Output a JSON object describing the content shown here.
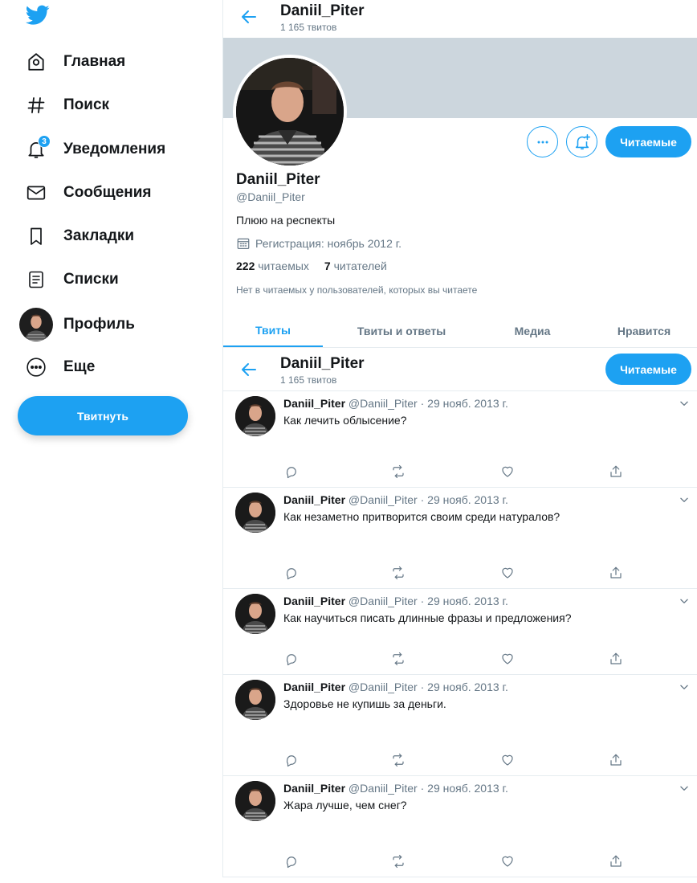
{
  "colors": {
    "accent": "#1da1f2",
    "text": "#14171a",
    "muted": "#657786",
    "banner": "#ccd6dd",
    "border": "#e6ecf0"
  },
  "sidebar": {
    "logo_icon": "twitter-bird-icon",
    "items": [
      {
        "label": "Главная",
        "icon": "home-icon"
      },
      {
        "label": "Поиск",
        "icon": "hashtag-icon"
      },
      {
        "label": "Уведомления",
        "icon": "bell-icon",
        "badge": "3"
      },
      {
        "label": "Сообщения",
        "icon": "envelope-icon"
      },
      {
        "label": "Закладки",
        "icon": "bookmark-icon"
      },
      {
        "label": "Списки",
        "icon": "list-icon"
      },
      {
        "label": "Профиль",
        "icon": "avatar"
      },
      {
        "label": "Еще",
        "icon": "more-icon"
      }
    ],
    "tweet_button": "Твитнуть"
  },
  "header": {
    "title": "Daniil_Piter",
    "subtitle": "1 165 твитов"
  },
  "profile": {
    "name": "Daniil_Piter",
    "handle": "@Daniil_Piter",
    "bio": "Плюю на респекты",
    "joined": "Регистрация: ноябрь 2012 г.",
    "following_count": "222",
    "following_label": "читаемых",
    "followers_count": "7",
    "followers_label": "читателей",
    "note": "Нет в читаемых у пользователей, которых вы читаете",
    "follow_button": "Читаемые"
  },
  "tabs": [
    {
      "label": "Твиты",
      "active": true
    },
    {
      "label": "Твиты и ответы",
      "active": false
    },
    {
      "label": "Медиа",
      "active": false
    },
    {
      "label": "Нравится",
      "active": false
    }
  ],
  "sticky": {
    "title": "Daniil_Piter",
    "subtitle": "1 165 твитов",
    "follow_button": "Читаемые"
  },
  "tweets": [
    {
      "name": "Daniil_Piter",
      "meta": "@Daniil_Piter · 29 нояб. 2013 г.",
      "text": "Как лечить облысение?"
    },
    {
      "name": "Daniil_Piter",
      "meta": "@Daniil_Piter · 29 нояб. 2013 г.",
      "text": "Как незаметно притворится своим среди натуралов?"
    },
    {
      "name": "Daniil_Piter",
      "meta": "@Daniil_Piter · 29 нояб. 2013 г.",
      "text": "Как научиться писать длинные фразы и предложения?"
    },
    {
      "name": "Daniil_Piter",
      "meta": "@Daniil_Piter · 29 нояб. 2013 г.",
      "text": "Здоровье не купишь за деньги."
    },
    {
      "name": "Daniil_Piter",
      "meta": "@Daniil_Piter · 29 нояб. 2013 г.",
      "text": "Жара лучше, чем снег?"
    }
  ]
}
